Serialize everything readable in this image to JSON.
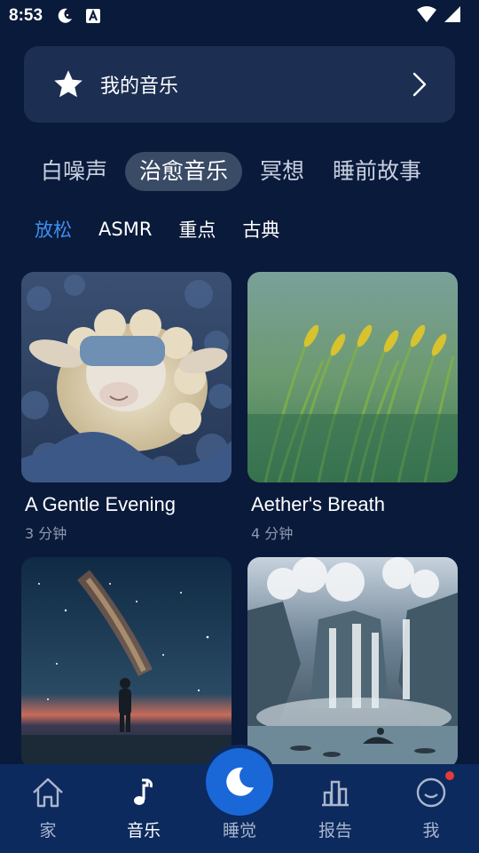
{
  "status_bar": {
    "time": "8:53"
  },
  "my_music": {
    "label": "我的音乐"
  },
  "category_tabs": [
    {
      "label": "白噪声",
      "active": false
    },
    {
      "label": "治愈音乐",
      "active": true
    },
    {
      "label": "冥想",
      "active": false
    },
    {
      "label": "睡前故事",
      "active": false
    }
  ],
  "sub_tabs": [
    {
      "label": "放松",
      "active": true
    },
    {
      "label": "ASMR",
      "active": false
    },
    {
      "label": "重点",
      "active": false
    },
    {
      "label": "古典",
      "active": false
    }
  ],
  "cards": [
    {
      "title": "A Gentle Evening",
      "duration": "3 分钟"
    },
    {
      "title": "Aether's Breath",
      "duration": "4 分钟"
    },
    {
      "title": "",
      "duration": ""
    },
    {
      "title": "",
      "duration": ""
    }
  ],
  "nav": {
    "home": "家",
    "music": "音乐",
    "sleep": "睡觉",
    "report": "报告",
    "me": "我"
  },
  "colors": {
    "background": "#0a1a3a",
    "accent": "#3d8ff0",
    "nav_bg": "#0c2a5e",
    "sleep_button": "#1a67d8",
    "badge": "#e63a3a"
  }
}
